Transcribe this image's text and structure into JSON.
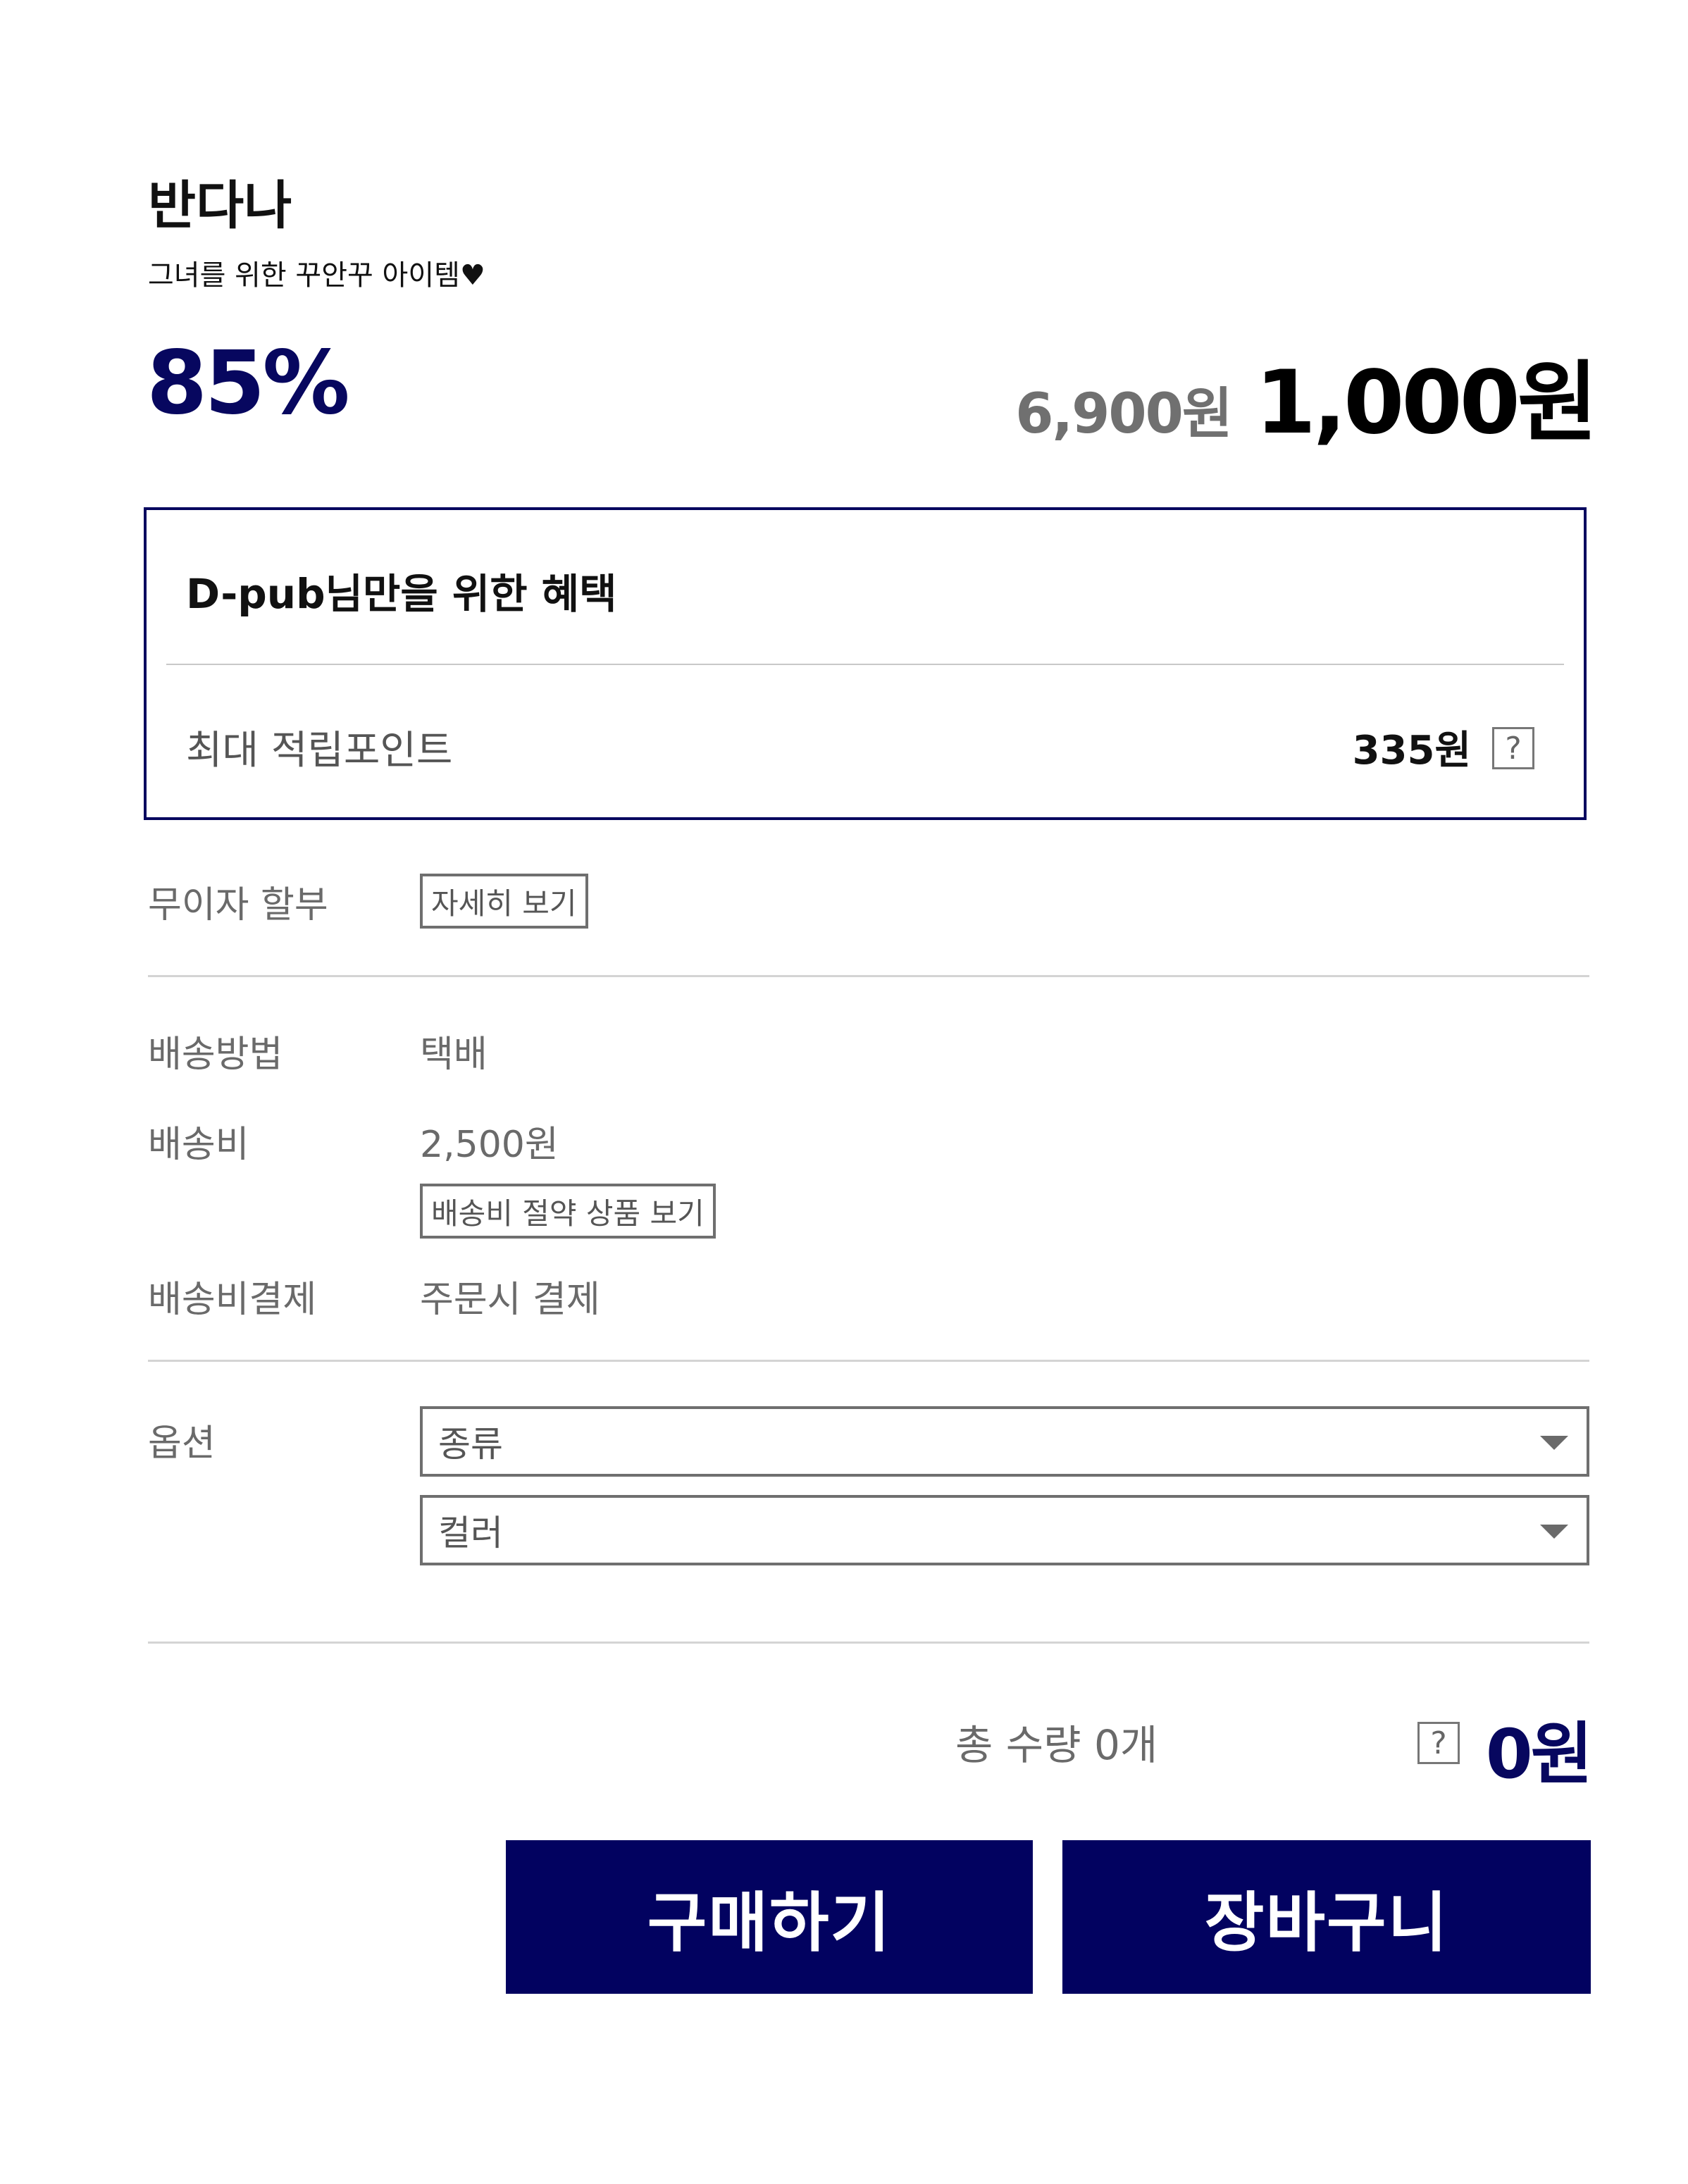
{
  "product": {
    "name": "반다나",
    "tagline": "그녀를 위한 꾸안꾸 아이템♥",
    "discount": "85%",
    "original_price": "6,900원",
    "sale_price": "1,000원"
  },
  "benefit": {
    "title": "D-pub님만을 위한 혜택",
    "point_label": "최대 적립포인트",
    "point_value": "335원",
    "help_glyph": "?"
  },
  "installment": {
    "label": "무이자 할부",
    "button": "자세히 보기"
  },
  "shipping": {
    "method_label": "배송방법",
    "method_value": "택배",
    "fee_label": "배송비",
    "fee_value": "2,500원",
    "save_button": "배송비 절약 상품 보기",
    "payment_label": "배송비결제",
    "payment_value": "주문시 결제"
  },
  "options": {
    "label": "옵션",
    "select_1": "종류",
    "select_2": "컬러"
  },
  "total": {
    "quantity_text": "총 수량 0개",
    "help_glyph": "?",
    "price": "0원"
  },
  "actions": {
    "buy_label": "구매하기",
    "cart_label": "장바구니"
  },
  "colors": {
    "accent": "#07075f",
    "button_bg": "#020260"
  }
}
